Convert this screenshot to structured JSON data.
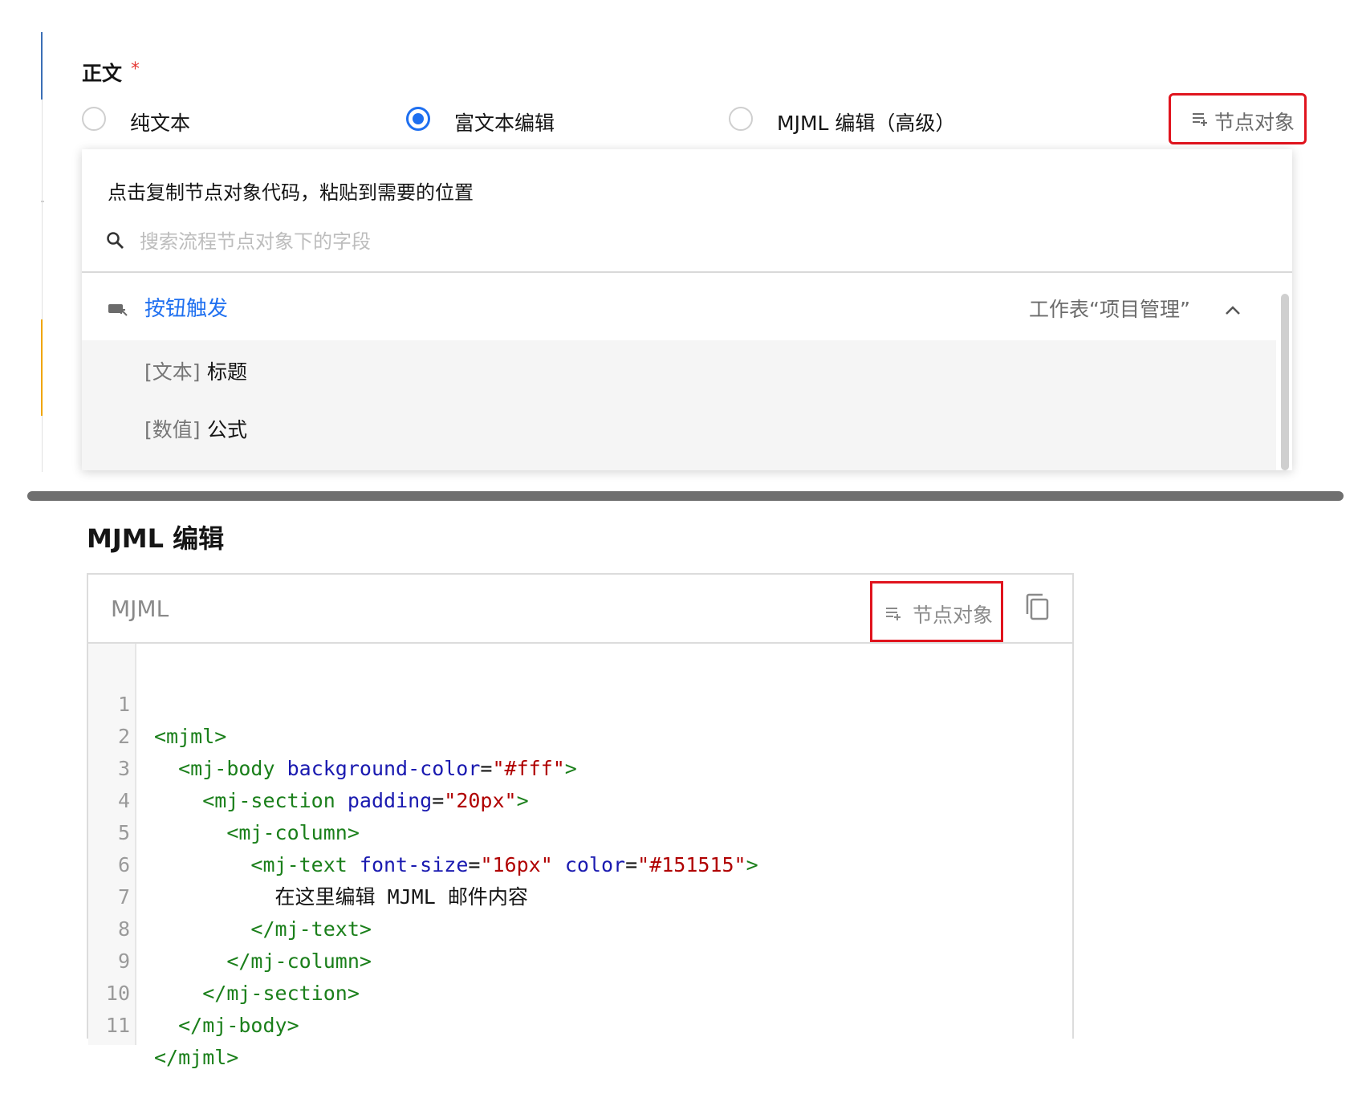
{
  "form": {
    "label": "正文",
    "required_mark": "*",
    "options": [
      {
        "label": "纯文本",
        "selected": false
      },
      {
        "label": "富文本编辑",
        "selected": true
      },
      {
        "label": "MJML 编辑（高级）",
        "selected": false
      }
    ],
    "node_object_button": "节点对象"
  },
  "node_panel": {
    "hint": "点击复制节点对象代码，粘贴到需要的位置",
    "search_placeholder": "搜索流程节点对象下的字段",
    "group": {
      "title": "按钮触发",
      "sheet": "工作表“项目管理”",
      "fields": [
        {
          "type": "[文本]",
          "name": "标题"
        },
        {
          "type": "[数值]",
          "name": "公式"
        }
      ]
    }
  },
  "mjml_section": {
    "heading": "MJML 编辑",
    "editor_title": "MJML",
    "node_object_button": "节点对象",
    "line_numbers": [
      "1",
      "2",
      "3",
      "4",
      "5",
      "6",
      "7",
      "8",
      "9",
      "10",
      "11"
    ],
    "code": {
      "l1_tag": "<mjml>",
      "l2_tag": "<mj-body",
      "l2_attr": "background-color",
      "l2_eq": "=",
      "l2_val": "\"#fff\"",
      "l2_close": ">",
      "l3_tag": "<mj-section",
      "l3_attr": "padding",
      "l3_eq": "=",
      "l3_val": "\"20px\"",
      "l3_close": ">",
      "l4_tag": "<mj-column>",
      "l5_tag": "<mj-text",
      "l5_attr1": "font-size",
      "l5_eq1": "=",
      "l5_val1": "\"16px\"",
      "l5_attr2": "color",
      "l5_eq2": "=",
      "l5_val2": "\"#151515\"",
      "l5_close": ">",
      "l6_text": "在这里编辑 MJML 邮件内容",
      "l7_tag": "</mj-text>",
      "l8_tag": "</mj-column>",
      "l9_tag": "</mj-section>",
      "l10_tag": "</mj-body>",
      "l11_tag": "</mjml>"
    }
  },
  "colors": {
    "accent": "#1e6ff0",
    "highlight_box": "#e0141e",
    "required": "#e53935"
  }
}
